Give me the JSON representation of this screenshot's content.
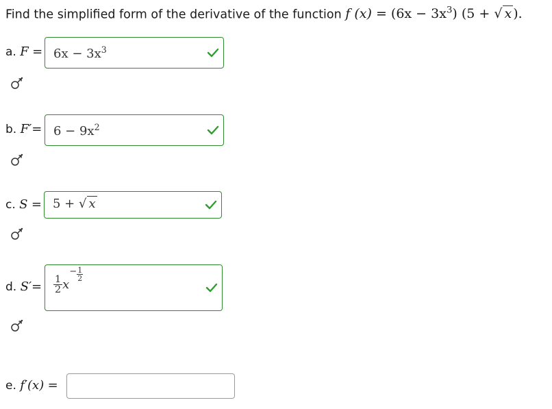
{
  "question": {
    "prompt": "Find the simplified form of the derivative of the function",
    "function_lhs": "f (x) =",
    "function_rhs_a": "(6x − 3x",
    "function_rhs_exp": "3",
    "function_rhs_b": ") (5 + √",
    "function_rhs_c": "x",
    "function_rhs_d": ").",
    "period": "."
  },
  "parts": [
    {
      "prefix": "a.",
      "symbol": "F",
      "eq": "=",
      "answer_main": "6x − 3x",
      "answer_exp": "3",
      "status": "correct"
    },
    {
      "prefix": "b.",
      "symbol": "F′",
      "eq": "=",
      "answer_main": "6 − 9x",
      "answer_exp": "2",
      "status": "correct"
    },
    {
      "prefix": "c.",
      "symbol": "S",
      "eq": "=",
      "answer_main": "5 + √",
      "answer_rad": "x",
      "status": "correct"
    },
    {
      "prefix": "d.",
      "symbol": "S′",
      "eq": "=",
      "answer_coef_num": "1",
      "answer_coef_den": "2",
      "answer_var": "x",
      "answer_exp_sign": "−",
      "answer_exp_num": "1",
      "answer_exp_den": "2",
      "status": "correct"
    },
    {
      "prefix": "e.",
      "symbol": "f′(x)",
      "eq": "=",
      "answer_main": "",
      "status": "empty"
    }
  ],
  "colors": {
    "correct": "#2e8b2e",
    "empty_border": "#9a9a9a",
    "check": "#2e9e2e"
  },
  "icons": {
    "tool": "equation-editor-icon",
    "check": "checkmark-icon"
  }
}
